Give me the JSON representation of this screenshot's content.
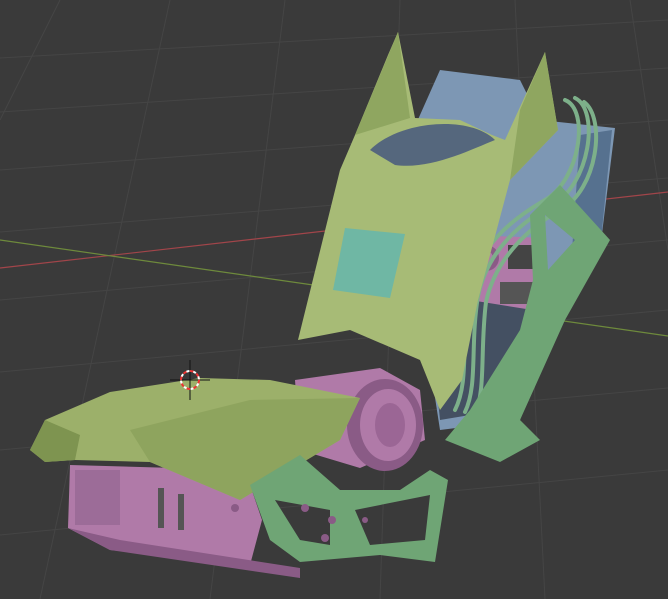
{
  "viewport": {
    "background": "#3a3a3a",
    "grid_color": "#454545",
    "x_axis_color": "#a2454a",
    "y_axis_color": "#6e8a3c"
  },
  "model": {
    "seat_color": "#9cb06a",
    "seat_shade": "#7e9450",
    "backrest_color": "#a7bb76",
    "panel_color": "#6fb7a4",
    "body_blue": "#7d97b4",
    "body_blue_dark": "#56718f",
    "pink_color": "#b07aa8",
    "pink_dark": "#8a5b86",
    "frame_green": "#6fa575",
    "cable_green": "#7db08a",
    "dark_interior": "#445062"
  },
  "icons": {
    "cursor": "3d-cursor-icon",
    "origin": "origin-dot-icon"
  }
}
